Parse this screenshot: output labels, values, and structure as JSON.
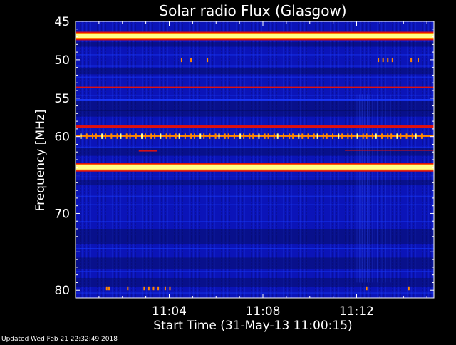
{
  "chart_data": {
    "type": "heatmap",
    "title": "Solar radio Flux (Glasgow)",
    "xlabel": "Start Time (31-May-13 11:00:15)",
    "ylabel": "Frequency [MHz]",
    "footer": "Updated Wed Feb 21 22:32:49 2018",
    "x_range_minutes": [
      0.0,
      15.3
    ],
    "xticks": [
      {
        "value": 4,
        "label": "11:04"
      },
      {
        "value": 8,
        "label": "11:08"
      },
      {
        "value": 12,
        "label": "11:12"
      }
    ],
    "y_range_mhz": [
      45,
      81
    ],
    "y_inverted": true,
    "yticks": [
      {
        "value": 45,
        "label": "45"
      },
      {
        "value": 50,
        "label": "50"
      },
      {
        "value": 55,
        "label": "55"
      },
      {
        "value": 60,
        "label": "60"
      },
      {
        "value": 70,
        "label": "70"
      },
      {
        "value": 80,
        "label": "80"
      }
    ],
    "colormap": {
      "background": "#0b14b8",
      "dark_band": "#050a55",
      "medium": "#1a3cff",
      "red": "#e01010",
      "orange": "#ff8800",
      "yellow": "#ffff88"
    },
    "emission_bands_mhz": [
      {
        "freq": 46.9,
        "width": 0.55,
        "intensity": "yellow"
      },
      {
        "freq": 50.8,
        "width": 0.15,
        "intensity": "medium"
      },
      {
        "freq": 53.6,
        "width": 0.2,
        "intensity": "red"
      },
      {
        "freq": 55.2,
        "width": 0.15,
        "intensity": "medium"
      },
      {
        "freq": 58.7,
        "width": 0.3,
        "intensity": "red"
      },
      {
        "freq": 59.9,
        "width": 0.25,
        "intensity": "orange"
      },
      {
        "freq": 64.0,
        "width": 0.55,
        "intensity": "yellow"
      }
    ],
    "grid": false
  }
}
